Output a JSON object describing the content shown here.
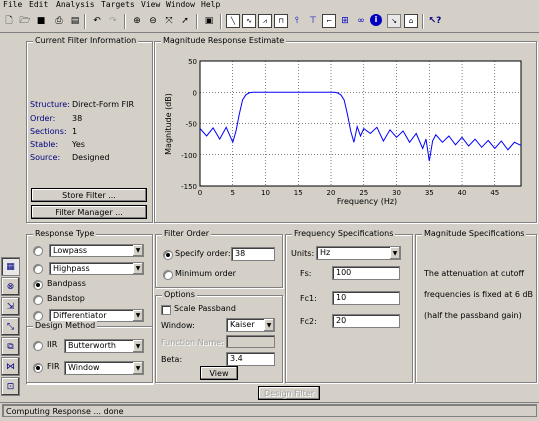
{
  "menu": [
    "File",
    "Edit",
    "Analysis",
    "Targets",
    "View",
    "Window",
    "Help"
  ],
  "toolbar_icons": [
    "new-icon",
    "open-icon",
    "save-icon",
    "print-icon",
    "print-preview-icon",
    "undo-icon",
    "redo-icon",
    "zoom-in-icon",
    "zoom-out-icon",
    "full-view-icon",
    "arrow-icon",
    "design-mode-icon",
    "magnitude-icon",
    "phase-icon",
    "mag-phase-icon",
    "group-delay-icon",
    "impulse-icon",
    "step-icon",
    "pole-zero-icon",
    "coefficients-icon",
    "info-icon",
    "filter-spec-icon",
    "zoom-fit-icon",
    "whats-this-icon"
  ],
  "current_filter": {
    "legend": "Current Filter Information",
    "rows": [
      {
        "label": "Structure:",
        "value": "Direct-Form FIR"
      },
      {
        "label": "Order:",
        "value": "38"
      },
      {
        "label": "Sections:",
        "value": "1"
      },
      {
        "label": "Stable:",
        "value": "Yes"
      },
      {
        "label": "Source:",
        "value": "Designed"
      }
    ],
    "store_button": "Store Filter ...",
    "manager_button": "Filter Manager ..."
  },
  "magnitude": {
    "legend": "Magnitude Response Estimate"
  },
  "chart_data": {
    "type": "line",
    "title": "",
    "xlabel": "Frequency (Hz)",
    "ylabel": "Magnitude (dB)",
    "xlim": [
      0,
      49
    ],
    "ylim": [
      -150,
      50
    ],
    "xticks": [
      0,
      5,
      10,
      15,
      20,
      25,
      30,
      35,
      40,
      45
    ],
    "yticks": [
      50,
      0,
      -50,
      -100,
      -150
    ],
    "grid": true,
    "line_color": "#0000ff",
    "x": [
      0,
      1,
      2,
      3,
      4,
      5,
      5.5,
      6,
      6.5,
      7,
      7.5,
      8,
      8.5,
      9,
      9.5,
      10,
      11,
      12,
      13,
      14,
      15,
      16,
      17,
      18,
      19,
      20,
      20.5,
      21,
      21.5,
      22,
      22.5,
      23,
      23.5,
      24,
      24.5,
      25,
      26,
      27,
      28,
      29,
      30,
      31,
      32,
      33,
      34,
      34.5,
      35,
      35.5,
      36,
      37,
      38,
      39,
      40,
      41,
      42,
      43,
      44,
      45,
      46,
      47,
      48,
      49
    ],
    "y": [
      -58,
      -70,
      -57,
      -75,
      -56,
      -80,
      -62,
      -35,
      -12,
      -4,
      -1,
      0,
      0,
      0,
      0,
      0,
      0,
      0,
      0,
      0,
      0,
      0,
      0,
      0,
      0,
      0,
      0,
      -1,
      -4,
      -12,
      -35,
      -62,
      -80,
      -55,
      -70,
      -58,
      -66,
      -56,
      -78,
      -60,
      -72,
      -62,
      -80,
      -66,
      -90,
      -75,
      -110,
      -78,
      -68,
      -80,
      -70,
      -84,
      -72,
      -86,
      -75,
      -88,
      -77,
      -90,
      -78,
      -92,
      -80,
      -85
    ]
  },
  "response_type": {
    "legend": "Response Type",
    "options": [
      "Lowpass",
      "Highpass",
      "Bandpass",
      "Bandstop",
      "Differentiator"
    ],
    "selected": "Bandpass"
  },
  "design_method": {
    "legend": "Design Method",
    "iir_label": "IIR",
    "iir_value": "Butterworth",
    "fir_label": "FIR",
    "fir_value": "Window",
    "selected": "FIR"
  },
  "filter_order": {
    "legend": "Filter Order",
    "specify_label": "Specify order:",
    "order_value": "38",
    "minimum_label": "Minimum order",
    "selected": "Specify order"
  },
  "options": {
    "legend": "Options",
    "scale_passband": "Scale Passband",
    "window_label": "Window:",
    "window_value": "Kaiser",
    "function_name_label": "Function Name:",
    "beta_label": "Beta:",
    "beta_value": "3.4",
    "view_button": "View"
  },
  "freq_specs": {
    "legend": "Frequency Specifications",
    "units_label": "Units:",
    "units_value": "Hz",
    "fields": [
      {
        "label": "Fs:",
        "value": "100"
      },
      {
        "label": "Fc1:",
        "value": "10"
      },
      {
        "label": "Fc2:",
        "value": "20"
      }
    ]
  },
  "mag_specs": {
    "legend": "Magnitude Specifications",
    "lines": [
      "The attenuation at cutoff",
      "frequencies is fixed at 6 dB",
      "(half the passband gain)"
    ]
  },
  "design_button": "Design Filter",
  "side_icons": [
    "filter-design-icon",
    "pole-zero-editor-icon",
    "import-filter-icon",
    "transform-icon",
    "convert-structure-icon",
    "multirate-icon",
    "realize-model-icon",
    "quantization-icon",
    "sidebar-extra-icon"
  ],
  "status": "Computing Response ... done"
}
